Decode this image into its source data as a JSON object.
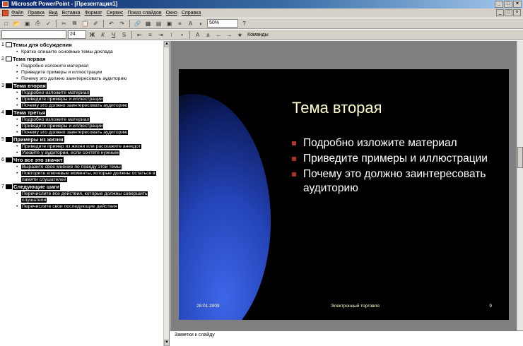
{
  "window": {
    "title": "Microsoft PowerPoint - [Презентация1]",
    "controls": [
      "_",
      "□",
      "×"
    ]
  },
  "menu": {
    "items": [
      "Файл",
      "Правка",
      "Вид",
      "Вставка",
      "Формат",
      "Сервис",
      "Показ слайдов",
      "Окно",
      "Справка"
    ]
  },
  "toolbar": {
    "zoom": "50%",
    "font": "",
    "size": "24",
    "bold": "Ж",
    "italic": "К",
    "underline": "Ч",
    "commands_label": "Команды"
  },
  "outline": [
    {
      "num": "1",
      "title": "Темы для обсуждения",
      "selected": false,
      "bullets": [
        "Кратко опишите основные темы доклада"
      ]
    },
    {
      "num": "2",
      "title": "Тема первая",
      "selected": false,
      "bullets": [
        "Подробно изложите материал",
        "Приведите примеры и иллюстрации",
        "Почему это должно заинтересовать аудиторию"
      ]
    },
    {
      "num": "3",
      "title": "Тема вторая",
      "selected": true,
      "bullets": [
        "Подробно изложите материал",
        "Приведите примеры и иллюстрации",
        "Почему это должно заинтересовать аудиторию"
      ]
    },
    {
      "num": "4",
      "title": "Тема третья",
      "selected": true,
      "bullets": [
        "Подробно изложите материал",
        "Приведите примеры и иллюстрации",
        "Почему это должно заинтересовать аудиторию"
      ]
    },
    {
      "num": "5",
      "title": "Примеры из жизни",
      "selected": true,
      "bullets": [
        "Приведите пример из жизни или расскажите анекдот",
        "Узнайте у аудитории, если сочтете нужным"
      ]
    },
    {
      "num": "6",
      "title": "Что все это значит",
      "selected": true,
      "bullets": [
        "Выразите свое мнение по поводу этой темы",
        "Повторите ключевые моменты, которые должны остаться в памяти слушателей"
      ]
    },
    {
      "num": "7",
      "title": "Следующие шаги",
      "selected": true,
      "bullets": [
        "Перечислите все действия, которые должны совершить слушатели",
        "Перечислите свои последующие действия"
      ]
    }
  ],
  "slide": {
    "title": "Тема вторая",
    "bullets": [
      "Подробно изложите материал",
      "Приведите примеры и иллюстрации",
      "Почему это должно заинтересовать аудиторию"
    ],
    "footer_date": "28.01.2009",
    "footer_text": "Электронный торговля",
    "footer_num": "9"
  },
  "notes": {
    "placeholder": "Заметки к слайду"
  }
}
